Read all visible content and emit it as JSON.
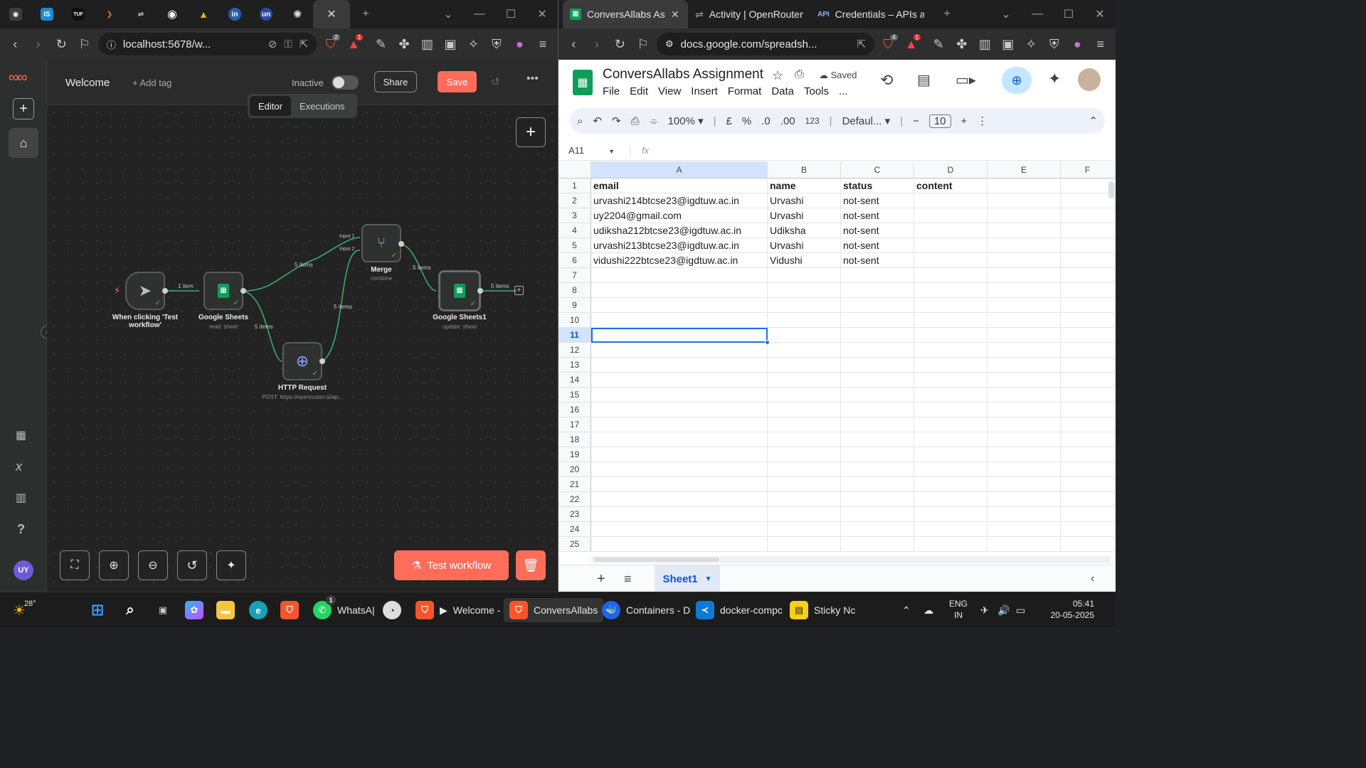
{
  "left_browser": {
    "tabs": [
      {
        "name": "tab-github-icon",
        "glyph": "◉",
        "color": "#3c3c3c"
      },
      {
        "name": "tab-is-icon",
        "glyph": "IS",
        "color": "#1a8bd8"
      },
      {
        "name": "tab-tuf-icon",
        "glyph": "TUF",
        "color": "#111111"
      },
      {
        "name": "tab-arrow-icon",
        "glyph": "❯",
        "color": "#e0802a"
      },
      {
        "name": "tab-openrouter-icon",
        "glyph": "⇌",
        "color": "#3c3c3c"
      },
      {
        "name": "tab-github2-icon",
        "glyph": "◉",
        "color": "#111111"
      },
      {
        "name": "tab-drive-icon",
        "glyph": "▲",
        "color": "#2a7de1"
      },
      {
        "name": "tab-linkedin-icon",
        "glyph": "in",
        "color": "#2a5ea8"
      },
      {
        "name": "tab-unstop-icon",
        "glyph": "un",
        "color": "#2b4a9c"
      },
      {
        "name": "tab-openai-icon",
        "glyph": "✺",
        "color": "#3c3c3c"
      }
    ],
    "url": "localhost:5678/w...",
    "badge_shield": "2",
    "badge_alert": "1"
  },
  "n8n": {
    "workflow_name": "Welcome",
    "add_tag": "+ Add tag",
    "status": "Inactive",
    "share": "Share",
    "save": "Save",
    "tab_editor": "Editor",
    "tab_executions": "Executions",
    "test_workflow": "Test workflow",
    "avatar": "UY",
    "nodes": {
      "trigger": {
        "label": "When clicking 'Test workflow'"
      },
      "sheets": {
        "label": "Google Sheets",
        "sub": "read: sheet"
      },
      "http": {
        "label": "HTTP Request",
        "sub": "POST: https://openrouter.ai/ap..."
      },
      "merge": {
        "label": "Merge",
        "sub": "combine",
        "input1": "Input 1",
        "input2": "Input 2"
      },
      "sheets1": {
        "label": "Google Sheets1",
        "sub": "update: sheet"
      }
    },
    "edges": {
      "e1": "1 item",
      "e2": "5 items",
      "e3": "5 items",
      "e4": "5 items",
      "e5": "5 items",
      "e6": "5 items"
    }
  },
  "right_browser": {
    "tabs": [
      {
        "label": "ConversAllabs Assi"
      },
      {
        "label": "Activity | OpenRouter"
      },
      {
        "label": "Credentials – APIs and"
      }
    ],
    "url": "docs.google.com/spreadsh...",
    "badge_shield": "4",
    "badge_alert": "1"
  },
  "sheets": {
    "title": "ConversAllabs Assignment",
    "saved": "Saved",
    "menu": [
      "File",
      "Edit",
      "View",
      "Insert",
      "Format",
      "Data",
      "Tools",
      "..."
    ],
    "zoom": "100%",
    "currency": "£",
    "percent": "%",
    "dec_minus": ".0",
    "dec_plus": ".00",
    "number_fmt": "123",
    "font": "Defaul...",
    "font_size": "10",
    "cell_ref": "A11",
    "fx": "fx",
    "columns": [
      "A",
      "B",
      "C",
      "D",
      "E",
      "F"
    ],
    "rows": [
      [
        "email",
        "name",
        "status",
        "content"
      ],
      [
        "urvashi214btcse23@igdtuw.ac.in",
        "Urvashi",
        "not-sent",
        ""
      ],
      [
        "uy2204@gmail.com",
        "Urvashi",
        "not-sent",
        ""
      ],
      [
        "udiksha212btcse23@igdtuw.ac.in",
        "Udiksha",
        "not-sent",
        ""
      ],
      [
        "urvashi213btcse23@igdtuw.ac.in",
        "Urvashi",
        "not-sent",
        ""
      ],
      [
        "vidushi222btcse23@igdtuw.ac.in",
        "Vidushi",
        "not-sent",
        ""
      ]
    ],
    "row_numbers": [
      "1",
      "2",
      "3",
      "4",
      "5",
      "6",
      "7",
      "8",
      "9",
      "10",
      "11",
      "12",
      "13",
      "14",
      "15",
      "16",
      "17",
      "18",
      "19",
      "20",
      "21",
      "22",
      "23",
      "24",
      "25"
    ],
    "sheet_tab": "Sheet1"
  },
  "taskbar": {
    "weather": "28°",
    "whatsapp": "WhatsA|",
    "whatsapp_badge": "1",
    "brave_welcome": "Welcome - I",
    "conversallabs": "ConversAllabs",
    "containers": "Containers - D",
    "docker": "docker-compc",
    "sticky": "Sticky Nc",
    "lang": "ENG",
    "region": "IN",
    "time": "05:41",
    "date": "20-05-2025"
  },
  "colors": {
    "n8n_accent": "#ff6d5a",
    "sheets_green": "#0f9d58",
    "selection_blue": "#1a73e8"
  }
}
